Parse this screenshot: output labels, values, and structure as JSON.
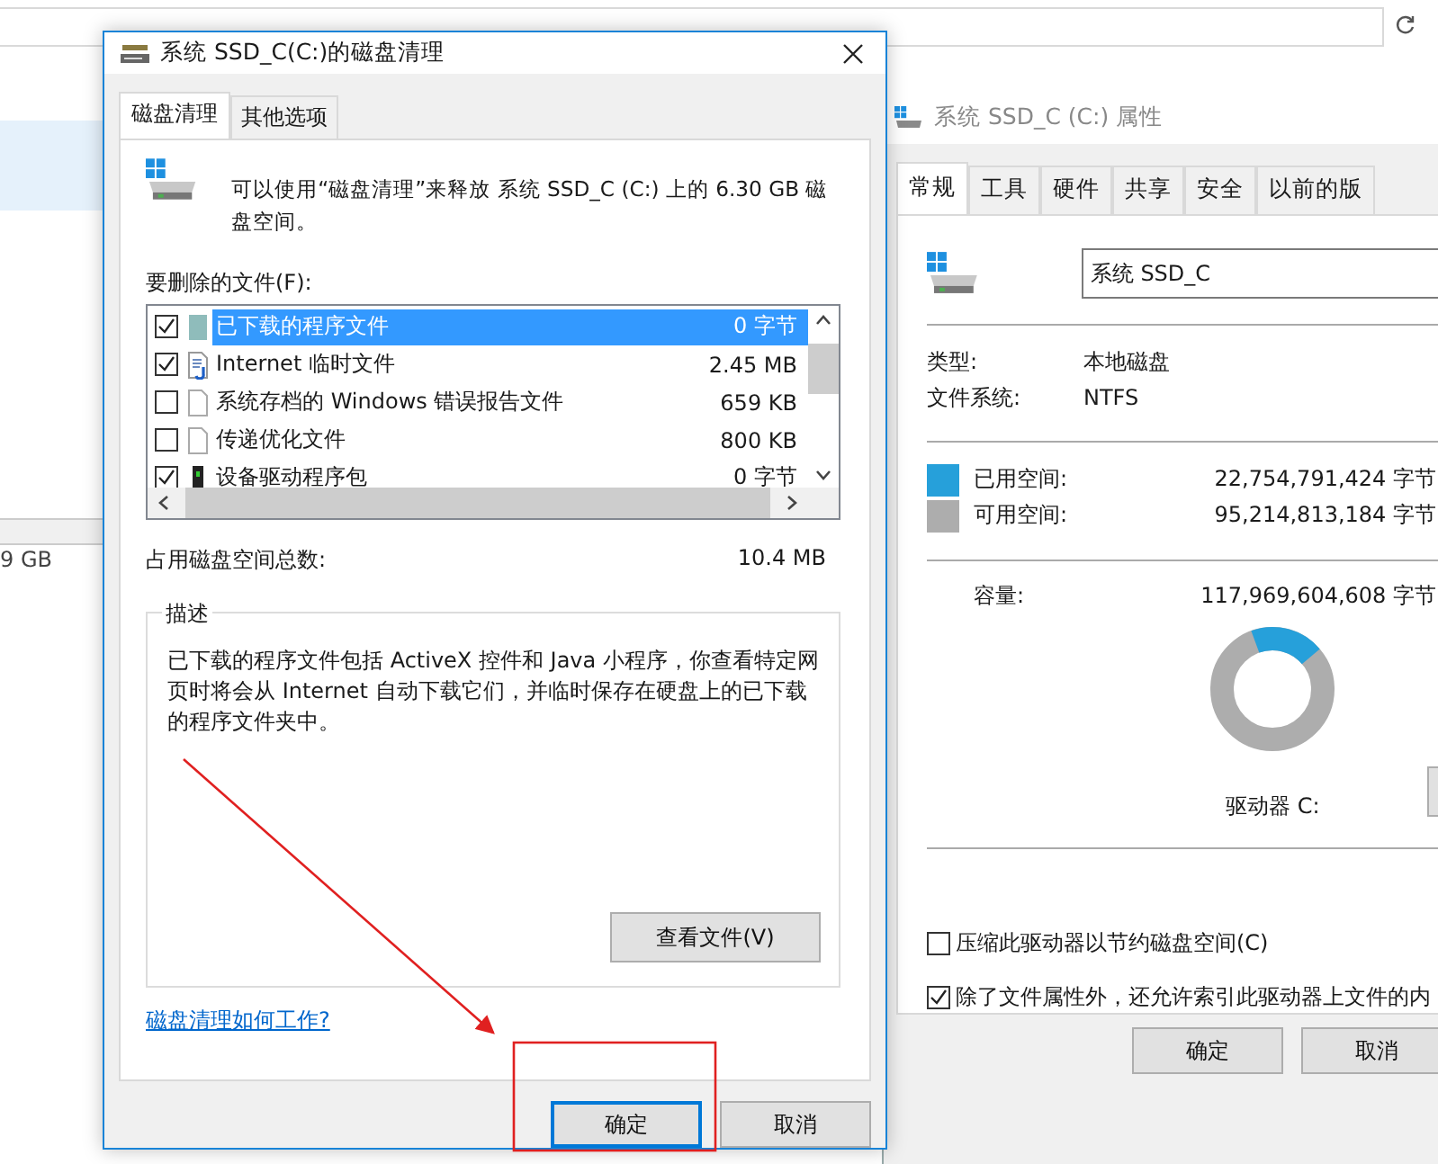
{
  "background_window": {
    "size_text": "9 GB"
  },
  "properties_dialog": {
    "title": "系统 SSD_C (C:) 属性",
    "tabs": [
      {
        "label": "常规",
        "selected": true
      },
      {
        "label": "工具",
        "selected": false
      },
      {
        "label": "硬件",
        "selected": false
      },
      {
        "label": "共享",
        "selected": false
      },
      {
        "label": "安全",
        "selected": false
      },
      {
        "label": "以前的版",
        "selected": false
      }
    ],
    "name_value": "系统 SSD_C",
    "info": [
      {
        "label": "类型:",
        "value": "本地磁盘"
      },
      {
        "label": "文件系统:",
        "value": "NTFS"
      }
    ],
    "space": [
      {
        "label": "已用空间:",
        "value": "22,754,791,424 字节",
        "color": "#26a0da"
      },
      {
        "label": "可用空间:",
        "value": "95,214,813,184 字节",
        "color": "#adadad"
      }
    ],
    "capacity": {
      "label": "容量:",
      "value": "117,969,604,608 字节"
    },
    "drive_label": "驱动器 C:",
    "options": [
      {
        "label": "压缩此驱动器以节约磁盘空间(C)",
        "checked": false
      },
      {
        "label": "除了文件属性外，还允许索引此驱动器上文件的内",
        "checked": true
      }
    ],
    "buttons": [
      "确定",
      "取消"
    ]
  },
  "cleanup_dialog": {
    "title": "系统 SSD_C(C:)的磁盘清理",
    "tabs": [
      {
        "label": "磁盘清理",
        "selected": true
      },
      {
        "label": "其他选项",
        "selected": false
      }
    ],
    "intro": "可以使用“磁盘清理”来释放 系统 SSD_C (C:) 上的 6.30 GB 磁盘空间。",
    "files_label": "要删除的文件(F):",
    "files": [
      {
        "name": "已下载的程序文件",
        "size": "0 字节",
        "checked": true,
        "selected": true,
        "kind": "folder"
      },
      {
        "name": "Internet 临时文件",
        "size": "2.45 MB",
        "checked": true,
        "selected": false,
        "kind": "web"
      },
      {
        "name": "系统存档的 Windows 错误报告文件",
        "size": "659 KB",
        "checked": false,
        "selected": false,
        "kind": "page"
      },
      {
        "name": "传递优化文件",
        "size": "800 KB",
        "checked": false,
        "selected": false,
        "kind": "page"
      },
      {
        "name": "设备驱动程序包",
        "size": "0 字节",
        "checked": true,
        "selected": false,
        "kind": "device"
      }
    ],
    "total": {
      "label": "占用磁盘空间总数:",
      "value": "10.4 MB"
    },
    "description": {
      "title": "描述",
      "text": "已下载的程序文件包括 ActiveX 控件和 Java 小程序，你查看特定网页时将会从 Internet 自动下载它们，并临时保存在硬盘上的已下载的程序文件夹中。"
    },
    "view_button": "查看文件(V)",
    "help_link": "磁盘清理如何工作?",
    "buttons": [
      {
        "label": "确定",
        "default": true
      },
      {
        "label": "取消",
        "default": false
      }
    ]
  }
}
